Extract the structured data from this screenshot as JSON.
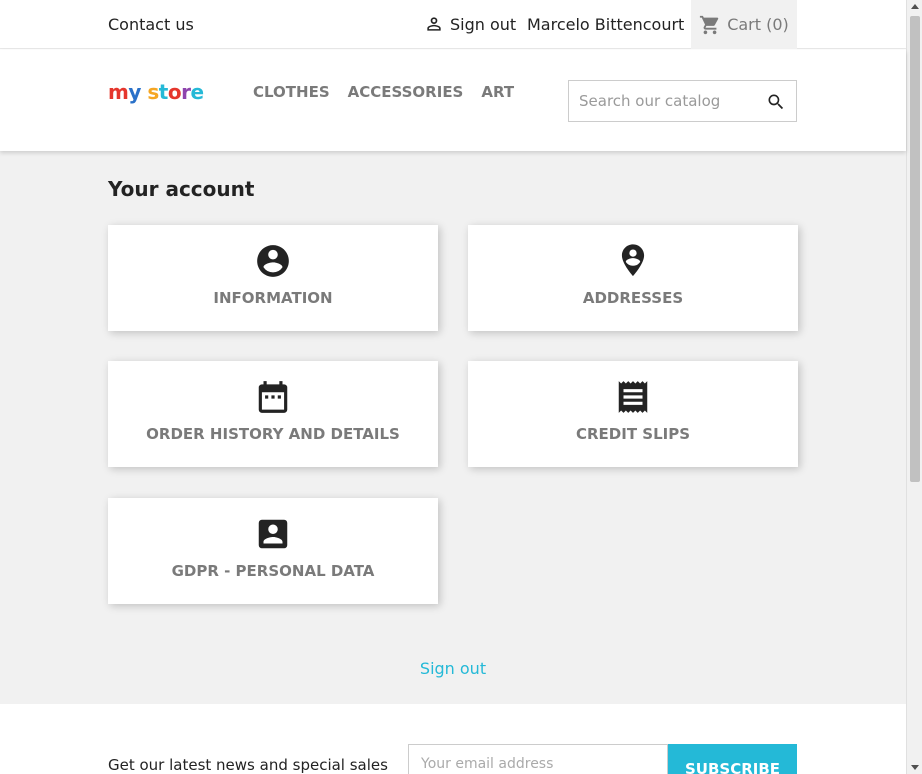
{
  "topbar": {
    "contact": "Contact us",
    "sign_out": "Sign out",
    "username": "Marcelo Bittencourt",
    "cart": "Cart (0)"
  },
  "header": {
    "logo": "my store",
    "nav": [
      "CLOTHES",
      "ACCESSORIES",
      "ART"
    ],
    "search_placeholder": "Search our catalog"
  },
  "main": {
    "title": "Your account",
    "cards": [
      {
        "label": "INFORMATION",
        "icon": "account-circle-icon"
      },
      {
        "label": "ADDRESSES",
        "icon": "location-pin-icon"
      },
      {
        "label": "ORDER HISTORY AND DETAILS",
        "icon": "calendar-icon"
      },
      {
        "label": "CREDIT SLIPS",
        "icon": "receipt-icon"
      },
      {
        "label": "GDPR - PERSONAL DATA",
        "icon": "contact-card-icon"
      }
    ],
    "sign_out": "Sign out"
  },
  "footer": {
    "newsletter_text": "Get our latest news and special sales",
    "email_placeholder": "Your email address",
    "subscribe": "SUBSCRIBE"
  },
  "colors": {
    "accent": "#24b9d7",
    "muted_text": "#7a7a7a",
    "page_bg": "#f1f1f1"
  }
}
